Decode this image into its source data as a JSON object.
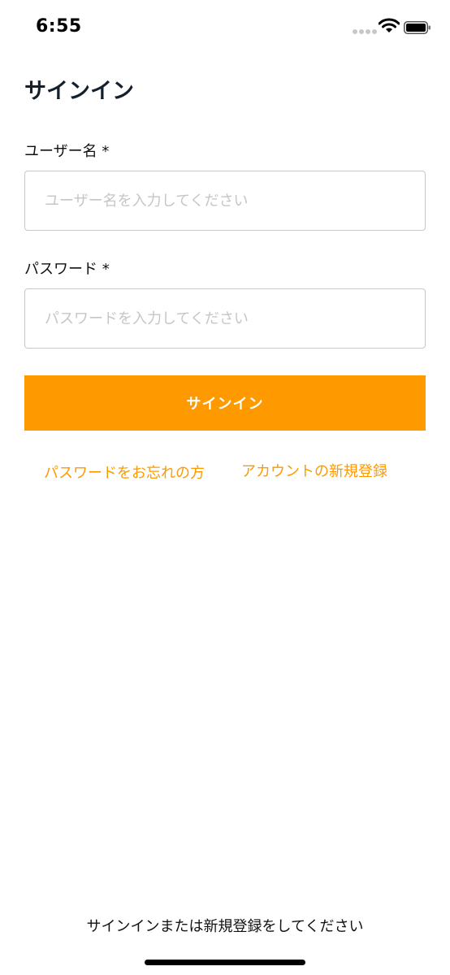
{
  "status_bar": {
    "time": "6:55",
    "icons": [
      "signal-dots-icon",
      "wifi-icon",
      "battery-icon"
    ]
  },
  "page": {
    "title": "サインイン"
  },
  "form": {
    "username": {
      "label": "ユーザー名 *",
      "placeholder": "ユーザー名を入力してください",
      "value": ""
    },
    "password": {
      "label": "パスワード *",
      "placeholder": "パスワードを入力してください",
      "value": ""
    },
    "submit_label": "サインイン"
  },
  "links": {
    "forgot_password": "パスワードをお忘れの方",
    "create_account": "アカウントの新規登録"
  },
  "footer": {
    "message": "サインインまたは新規登録をしてください"
  },
  "colors": {
    "accent": "#ff9900",
    "title": "#15202b",
    "input_border": "#c4c7cc",
    "placeholder": "#c6c6c6"
  }
}
